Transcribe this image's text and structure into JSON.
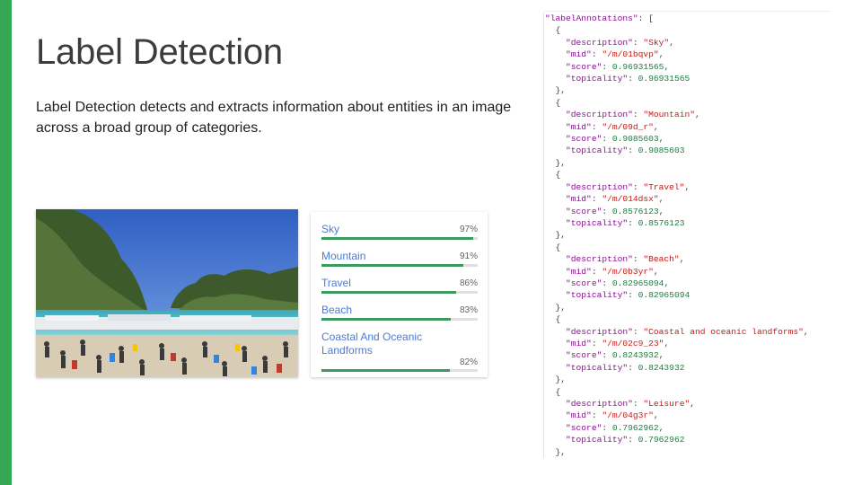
{
  "slide": {
    "title": "Label Detection",
    "subtitle": "Label Detection detects and extracts information about entities in an image across a broad group of categories."
  },
  "colors": {
    "accent": "#34a853",
    "label_text": "#4e79d6",
    "bar_fill": "#3c9a5f"
  },
  "labels": [
    {
      "name": "Sky",
      "percent": "97%",
      "score": 0.97
    },
    {
      "name": "Mountain",
      "percent": "91%",
      "score": 0.91
    },
    {
      "name": "Travel",
      "percent": "86%",
      "score": 0.86
    },
    {
      "name": "Beach",
      "percent": "83%",
      "score": 0.83
    },
    {
      "name": "Coastal And Oceanic Landforms",
      "percent": "82%",
      "score": 0.82
    }
  ],
  "json": {
    "root_key": "labelAnnotations",
    "annotations": [
      {
        "description": "Sky",
        "mid": "/m/01bqvp",
        "score": "0.96931565",
        "topicality": "0.96931565"
      },
      {
        "description": "Mountain",
        "mid": "/m/09d_r",
        "score": "0.9085603",
        "topicality": "0.9085603"
      },
      {
        "description": "Travel",
        "mid": "/m/014dsx",
        "score": "0.8576123",
        "topicality": "0.8576123"
      },
      {
        "description": "Beach",
        "mid": "/m/0b3yr",
        "score": "0.82965094",
        "topicality": "0.82965094"
      },
      {
        "description": "Coastal and oceanic landforms",
        "mid": "/m/02c9_23",
        "score": "0.8243932",
        "topicality": "0.8243932"
      },
      {
        "description": "Leisure",
        "mid": "/m/04g3r",
        "score": "0.7962962",
        "topicality": "0.7962962"
      }
    ]
  }
}
